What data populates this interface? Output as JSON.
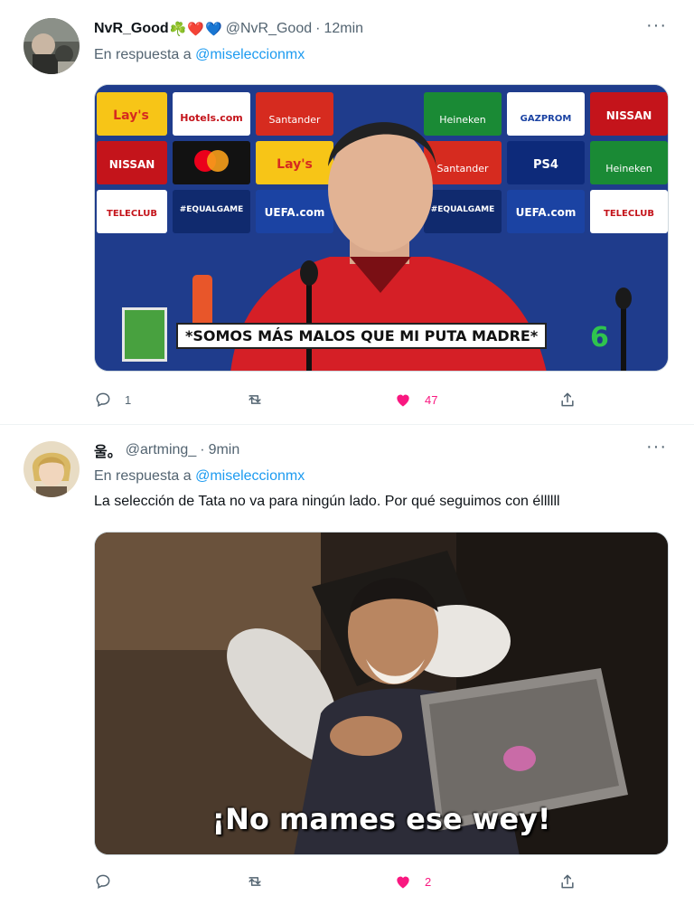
{
  "tweets": [
    {
      "display_name": "NvR_Good",
      "name_emojis": [
        "☘️",
        "❤️",
        "💙"
      ],
      "handle": "@NvR_Good",
      "separator": "·",
      "time": "12min",
      "reply_prefix": "En respuesta a",
      "reply_mention": "@miseleccionmx",
      "text": "",
      "media": {
        "subtitle": "*SOMOS MÁS MALOS QUE MI PUTA MADRE*",
        "sponsors": [
          "Lay's",
          "Hotels.com",
          "Santander",
          "Heineken",
          "GAZPROM",
          "NISSAN",
          "NISSAN",
          "mastercard",
          "Lay's",
          "Santander",
          "PS4",
          "Heineken",
          "TELECLUB",
          "#EQUALGAME",
          "UEFA.com",
          "#EQUALGAME",
          "UEFA.com",
          "TELECLUB"
        ],
        "channel_badge": "6"
      },
      "counts": {
        "reply": "1",
        "retweet": "",
        "like": "47"
      }
    },
    {
      "display_name": "울。",
      "handle": "@artming_",
      "separator": "·",
      "time": "9min",
      "reply_prefix": "En respuesta a",
      "reply_mention": "@miseleccionmx",
      "text": "La selección de Tata no va para ningún lado. Por qué seguimos con éllllll",
      "media": {
        "caption": "¡No mames ese wey!"
      },
      "counts": {
        "reply": "",
        "retweet": "",
        "like": "2"
      }
    }
  ],
  "icons": {
    "more": "more-horizontal-icon",
    "reply": "reply-bubble-icon",
    "retweet": "retweet-icon",
    "like": "heart-filled-icon",
    "share": "share-upload-icon"
  },
  "colors": {
    "link": "#1d9bf0",
    "like": "#f91880",
    "secondary_text": "#536471",
    "primary_text": "#0f1419"
  }
}
